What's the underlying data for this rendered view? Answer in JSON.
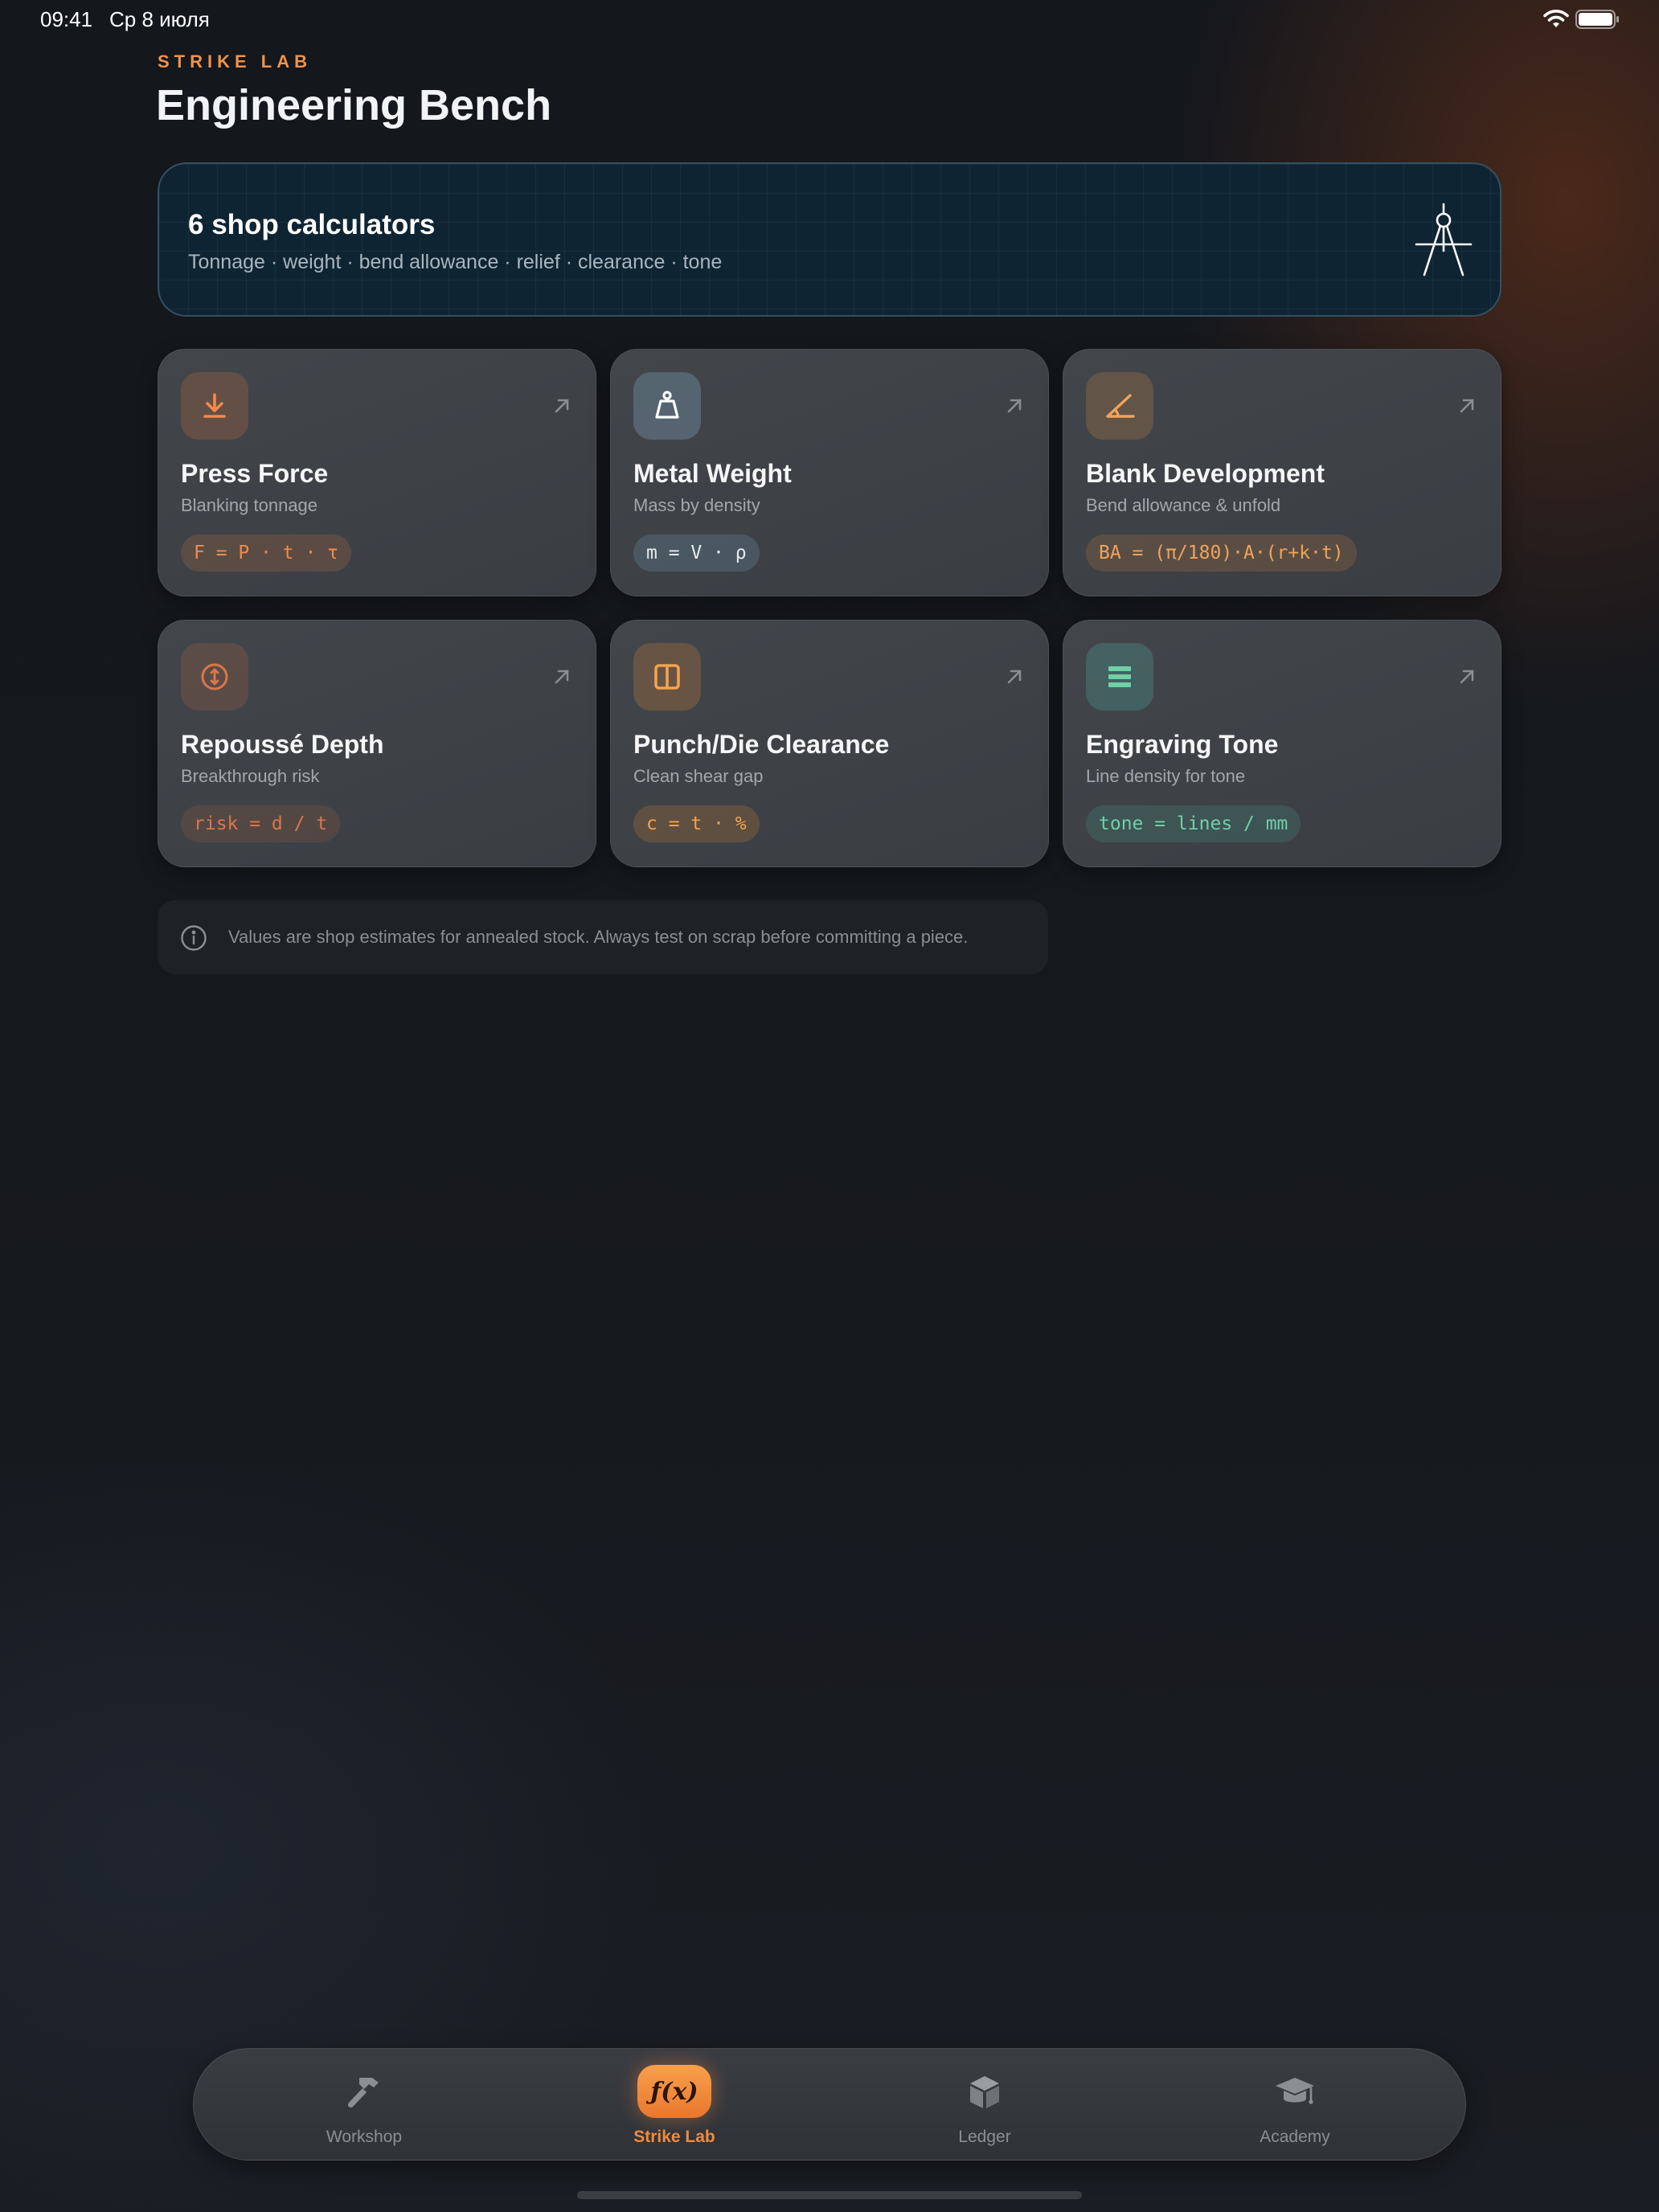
{
  "status_bar": {
    "time": "09:41",
    "date": "Ср 8 июля",
    "wifi_icon": "wifi-icon",
    "battery_icon": "battery-icon"
  },
  "header": {
    "eyebrow": "STRIKE LAB",
    "title": "Engineering Bench"
  },
  "hero": {
    "title": "6 shop calculators",
    "subtitle": "Tonnage · weight · bend allowance · relief · clearance · tone",
    "icon": "drafting-compass-icon"
  },
  "calculators": [
    {
      "title": "Press Force",
      "subtitle": "Blanking tonnage",
      "formula": "F = P · t · τ",
      "icon": "press-down-icon",
      "accent": "#f08a4b"
    },
    {
      "title": "Metal Weight",
      "subtitle": "Mass by density",
      "formula": "m = V · ρ",
      "icon": "weight-icon",
      "accent": "#e6eaed"
    },
    {
      "title": "Blank Development",
      "subtitle": "Bend allowance & unfold",
      "formula": "BA = (π/180)·A·(r+k·t)",
      "icon": "angle-icon",
      "accent": "#f0a35a"
    },
    {
      "title": "Repoussé Depth",
      "subtitle": "Breakthrough risk",
      "formula": "risk = d / t",
      "icon": "depth-icon",
      "accent": "#d9774a"
    },
    {
      "title": "Punch/Die Clearance",
      "subtitle": "Clean shear gap",
      "formula": "c = t · %",
      "icon": "split-square-icon",
      "accent": "#f3a24e"
    },
    {
      "title": "Engraving Tone",
      "subtitle": "Line density for tone",
      "formula": "tone = lines / mm",
      "icon": "lines-icon",
      "accent": "#6fd0a6"
    }
  ],
  "note": {
    "icon": "info-icon",
    "text": "Values are shop estimates for annealed stock. Always test on scrap before committing a piece."
  },
  "tab_bar": {
    "tabs": [
      {
        "label": "Workshop",
        "icon": "hammer-icon",
        "active": false
      },
      {
        "label": "Strike Lab",
        "icon": "function-icon",
        "glyph": "ƒ(x)",
        "active": true
      },
      {
        "label": "Ledger",
        "icon": "box-icon",
        "active": false
      },
      {
        "label": "Academy",
        "icon": "graduation-cap-icon",
        "active": false
      }
    ]
  }
}
